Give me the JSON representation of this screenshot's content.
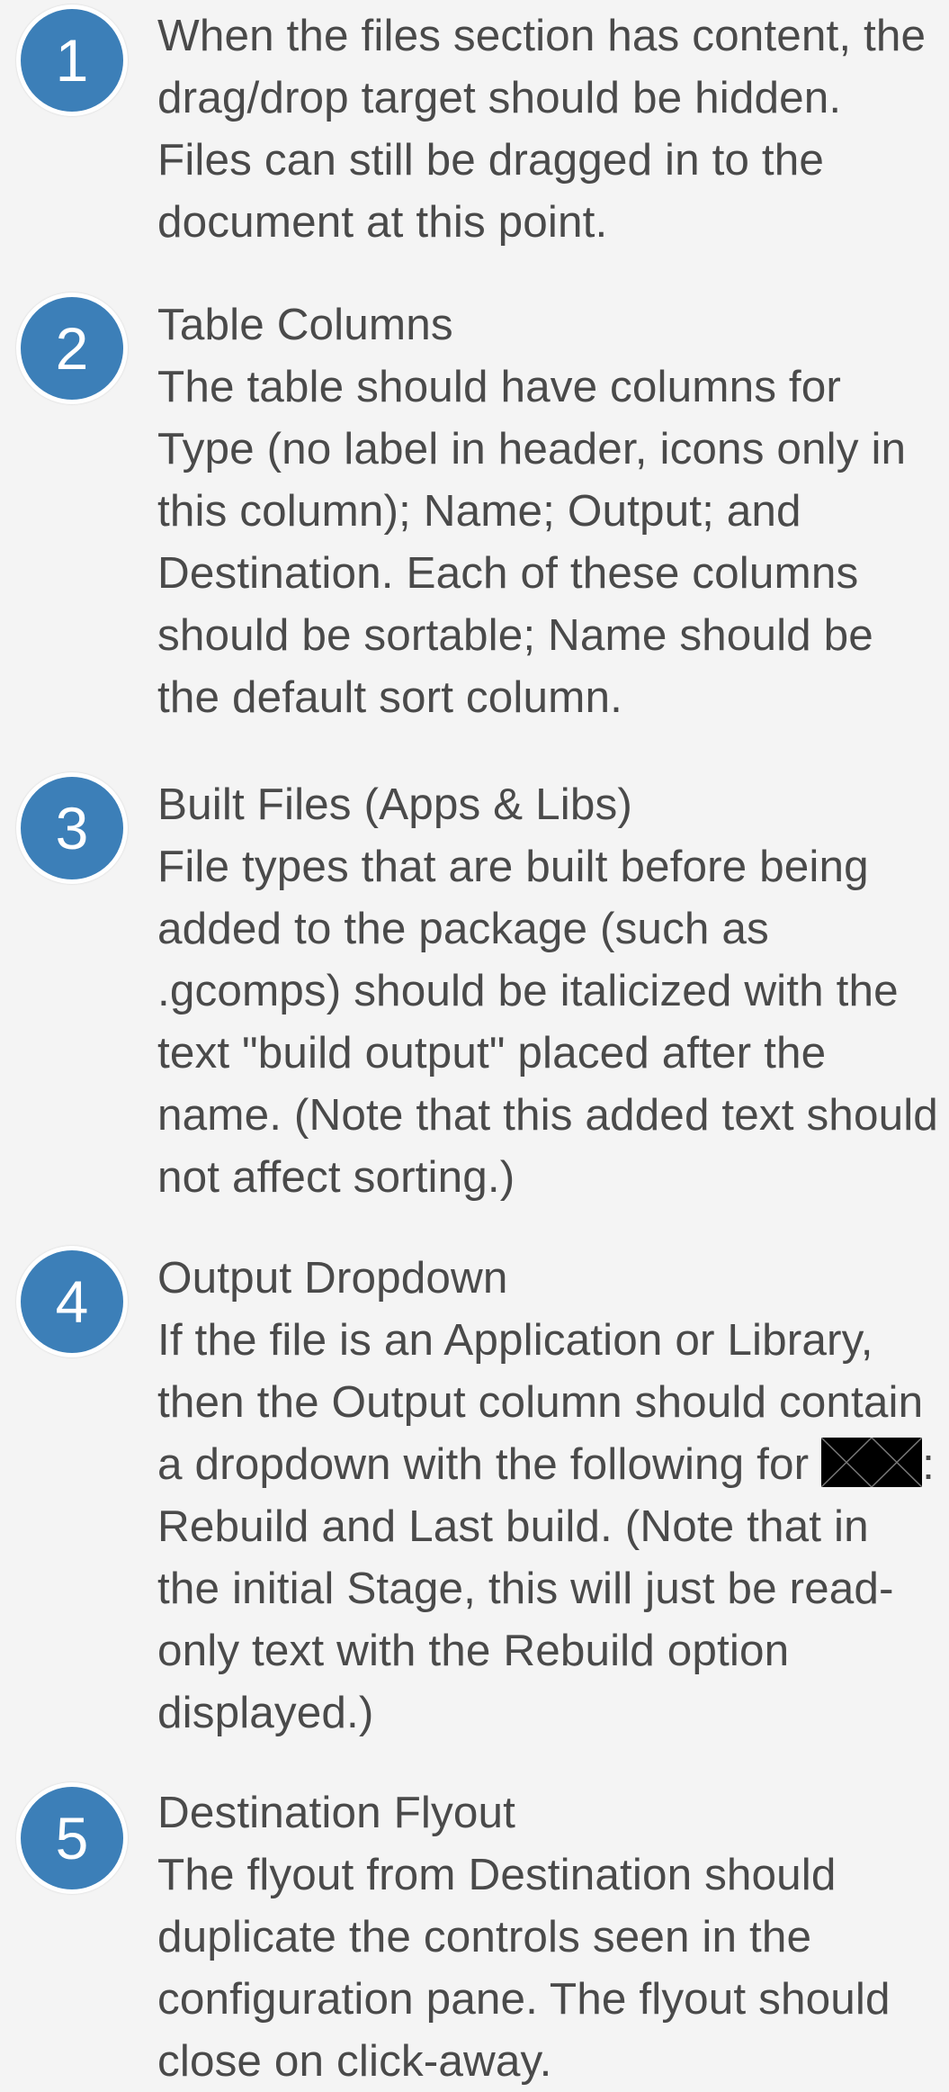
{
  "notes": [
    {
      "number": "1",
      "title": "",
      "text": "When the files section has content, the drag/drop target should be hidden. Files can still be dragged in to the document at this point."
    },
    {
      "number": "2",
      "title": "Table Columns",
      "text": "The table should have columns for Type (no label in header, icons only in this column); Name; Output; and Destination. Each of these columns should be sortable; Name should be the default sort column."
    },
    {
      "number": "3",
      "title": "Built Files (Apps & Libs)",
      "text": "File types that are built before being added to the package (such as .gcomps) should be italicized with the text \"build output\" placed after the name. (Note that this added text should not affect sorting.)"
    },
    {
      "number": "4",
      "title": "Output Dropdown",
      "text_before": "If the file is an Application or Library, then the Output column should contain a dropdown with the following for",
      "text_after": ": Rebuild and Last build. (Note that in the initial Stage, this will just be read-only text with the Rebuild option displayed.)"
    },
    {
      "number": "5",
      "title": "Destination Flyout",
      "text": "The flyout from Destination should duplicate the controls seen in the configuration pane. The flyout should close on click-away."
    }
  ],
  "colors": {
    "badge": "#3c7fb8",
    "text": "#4a4a4a",
    "background": "#f4f4f4"
  }
}
